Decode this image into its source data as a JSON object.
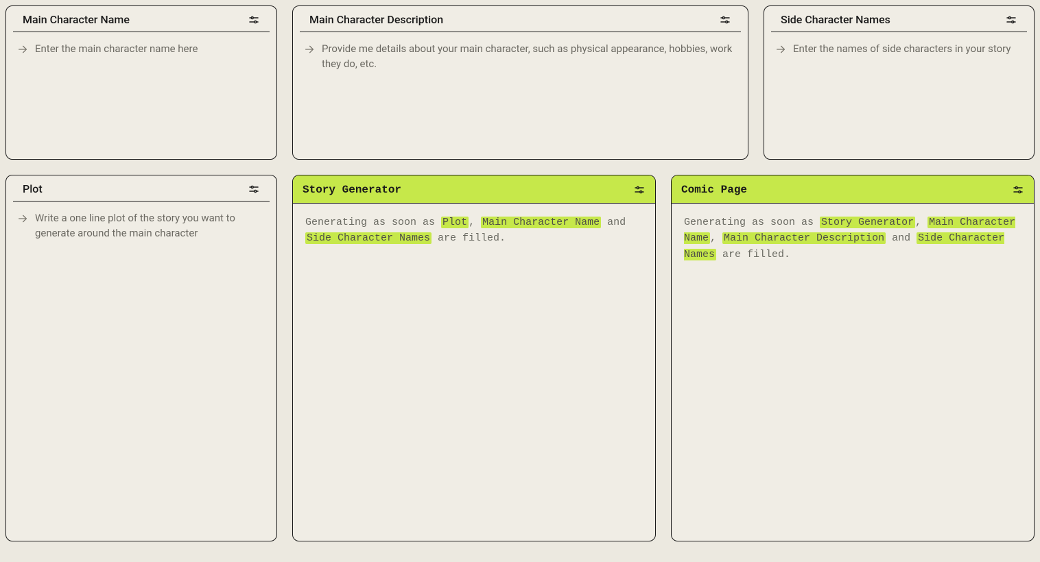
{
  "cards": {
    "mainCharName": {
      "title": "Main Character Name",
      "placeholder": "Enter the main character name here"
    },
    "mainCharDesc": {
      "title": "Main Character Description",
      "placeholder": "Provide me details about your main character, such as physical appearance, hobbies, work they do, etc."
    },
    "sideCharNames": {
      "title": "Side Character Names",
      "placeholder": "Enter the names of side characters in your story"
    },
    "plot": {
      "title": "Plot",
      "placeholder": "Write a one line plot of the story you want to generate around the main character"
    },
    "storyGen": {
      "title": "Story Generator",
      "prefix": "Generating as soon as ",
      "dep1": "Plot",
      "sep1": ", ",
      "dep2": "Main Character Name",
      "sep2": " and ",
      "dep3": "Side Character Names",
      "suffix": " are filled."
    },
    "comicPage": {
      "title": "Comic Page",
      "prefix": "Generating as soon as ",
      "dep1": "Story Generator",
      "sep1": ", ",
      "dep2": "Main Character Name",
      "sep2": ", ",
      "dep3": "Main Character Description",
      "sep3": " and ",
      "dep4": "Side Character Names",
      "suffix": " are filled."
    }
  }
}
